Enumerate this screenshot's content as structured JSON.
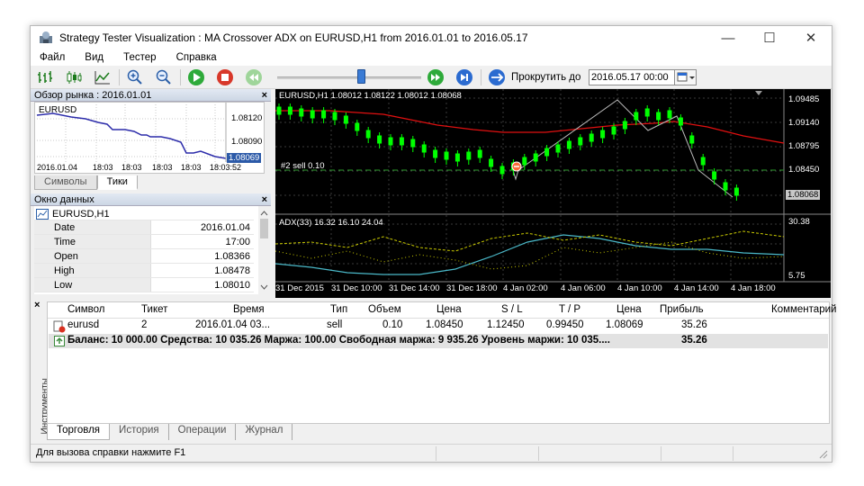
{
  "window": {
    "title": "Strategy Tester Visualization : MA Crossover ADX on EURUSD,H1 from 2016.01.01 to 2016.05.17",
    "minimize": "—",
    "maximize": "☐",
    "close": "✕"
  },
  "menu": [
    "Файл",
    "Вид",
    "Тестер",
    "Справка"
  ],
  "toolbar": {
    "scroll_label": "Прокрутить до",
    "date_value": "2016.05.17 00:00",
    "date_drop": "▼",
    "slider_level": 0.58
  },
  "market_watch": {
    "title": "Обзор рынка : 2016.01.01",
    "close": "×",
    "symbol": "EURUSD",
    "price_levels": [
      "1.08120",
      "1.08090",
      "1.08069"
    ],
    "times": [
      "2016.01.04",
      "18:03",
      "18:03",
      "18:03",
      "18:03",
      "18:03:52"
    ],
    "tabs": [
      "Символы",
      "Тики"
    ]
  },
  "data_window": {
    "title": "Окно данных",
    "close": "×",
    "symbol": "EURUSD,H1",
    "rows": [
      {
        "k": "Date",
        "v": "2016.01.04"
      },
      {
        "k": "Time",
        "v": "17:00"
      },
      {
        "k": "Open",
        "v": "1.08366"
      },
      {
        "k": "High",
        "v": "1.08478"
      },
      {
        "k": "Low",
        "v": "1.08010"
      }
    ]
  },
  "chart": {
    "header": "EURUSD,H1  1.08012 1.08122 1.08012 1.08068",
    "order_label": "#2 sell 0.10",
    "price_scale": [
      "1.09485",
      "1.09140",
      "1.08795",
      "1.08450"
    ],
    "current_price": "1.08068",
    "adx_header": "ADX(33) 16.32 16.10 24.04",
    "adx_scale": [
      "30.38",
      "5.75"
    ],
    "time_axis": [
      "31 Dec 2015",
      "31 Dec 10:00",
      "31 Dec 14:00",
      "31 Dec 18:00",
      "4 Jan 02:00",
      "4 Jan 06:00",
      "4 Jan 10:00",
      "4 Jan 14:00",
      "4 Jan 18:00"
    ],
    "colors": {
      "bull": "#00ff00",
      "ma": "#ff2020",
      "adx_main": "#4ab8c8",
      "adx_dash": "#c8c800"
    }
  },
  "terminal": {
    "close": "×",
    "side_label": "Инструменты",
    "headers": [
      "Символ",
      "Тикет",
      "Время",
      "Тип",
      "Объем",
      "Цена",
      "S / L",
      "T / P",
      "Цена",
      "Прибыль",
      "Комментарий"
    ],
    "row": [
      "eurusd",
      "2",
      "2016.01.04 03...",
      "sell",
      "0.10",
      "1.08450",
      "1.12450",
      "0.99450",
      "1.08069",
      "35.26",
      ""
    ],
    "summary": "Баланс: 10 000.00  Средства: 10 035.26  Маржа: 100.00  Свободная маржа: 9 935.26  Уровень маржи: 10 035....",
    "summary_profit": "35.26",
    "tabs": [
      "Торговля",
      "История",
      "Операции",
      "Журнал"
    ]
  },
  "status": {
    "text": "Для вызова справки нажмите F1"
  }
}
